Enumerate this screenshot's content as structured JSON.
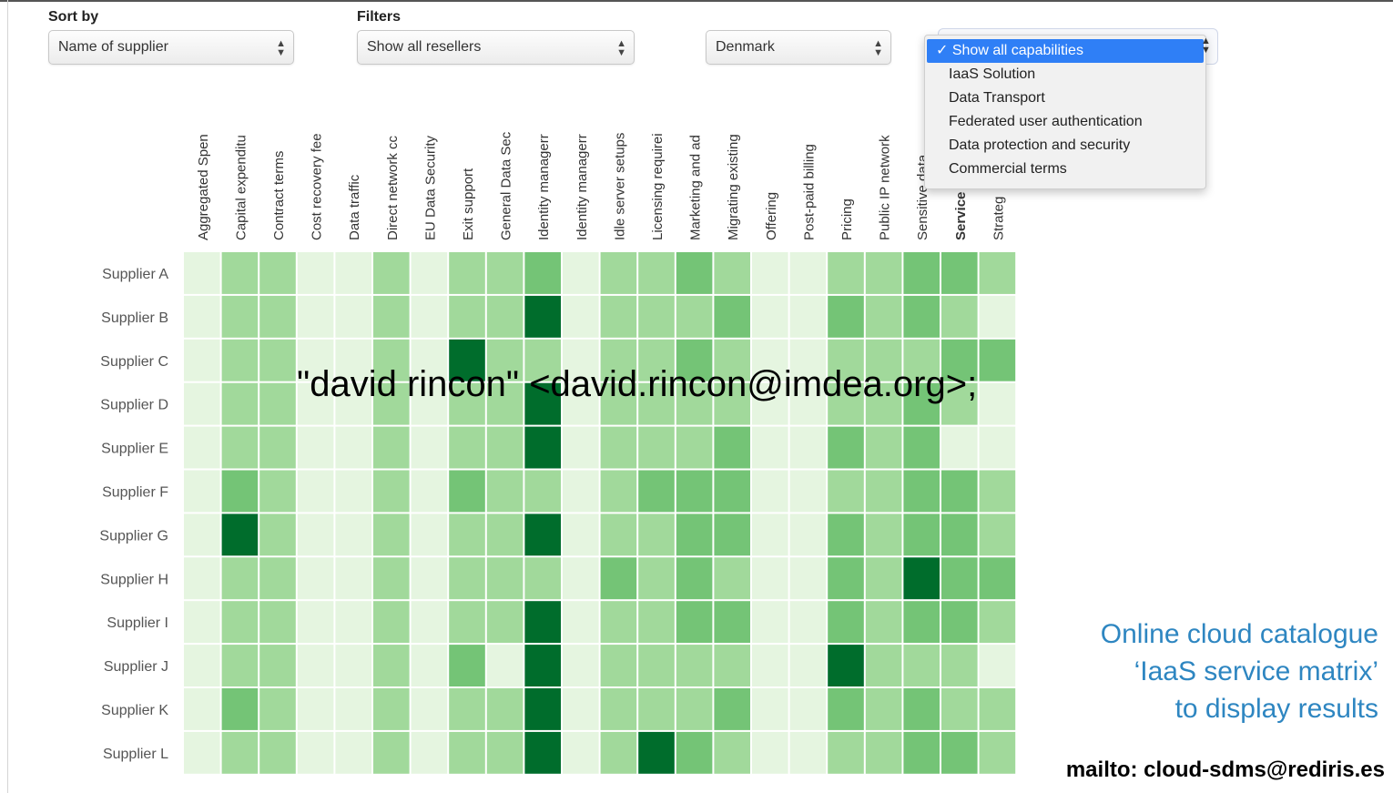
{
  "controls": {
    "sort_label": "Sort by",
    "filters_label": "Filters",
    "sort_value": "Name of supplier",
    "reseller_value": "Show all resellers",
    "country_value": "Denmark"
  },
  "capability_menu": {
    "selected": "Show all capabilities",
    "options": [
      "IaaS Solution",
      "Data Transport",
      "Federated user authentication",
      "Data protection and security",
      "Commercial terms"
    ]
  },
  "chart_data": {
    "type": "heatmap",
    "value_scale": "0 = lightest green, 4 = darkest green",
    "columns": [
      "Aggregated Spen",
      "Capital expenditu",
      "Contract terms",
      "Cost recovery fee",
      "Data traffic",
      "Direct network cc",
      "EU Data Security",
      "Exit support",
      "General Data Sec",
      "Identity managerr",
      "Identity managerr",
      "Idle server setups",
      "Licensing requirei",
      "Marketing and ad",
      "Migrating existing",
      "Offering",
      "Post-paid billing",
      "Pricing",
      "Public IP network",
      "Sensitive data",
      "Service",
      "Strateg"
    ],
    "bold_column": "Service",
    "rows": [
      "Supplier A",
      "Supplier B",
      "Supplier C",
      "Supplier D",
      "Supplier E",
      "Supplier F",
      "Supplier G",
      "Supplier H",
      "Supplier I",
      "Supplier J",
      "Supplier K",
      "Supplier L"
    ],
    "values": [
      [
        0,
        1,
        1,
        0,
        0,
        1,
        0,
        1,
        1,
        2,
        0,
        1,
        1,
        2,
        1,
        0,
        0,
        1,
        1,
        2,
        2,
        1
      ],
      [
        0,
        1,
        1,
        0,
        0,
        1,
        0,
        1,
        1,
        4,
        0,
        1,
        1,
        1,
        2,
        0,
        0,
        2,
        1,
        2,
        1,
        0
      ],
      [
        0,
        1,
        1,
        0,
        0,
        1,
        0,
        4,
        1,
        1,
        0,
        1,
        1,
        2,
        1,
        0,
        0,
        1,
        1,
        1,
        2,
        2
      ],
      [
        0,
        1,
        1,
        0,
        0,
        1,
        0,
        1,
        1,
        4,
        0,
        1,
        1,
        1,
        1,
        0,
        0,
        1,
        1,
        2,
        1,
        0
      ],
      [
        0,
        1,
        1,
        0,
        0,
        1,
        0,
        1,
        1,
        4,
        0,
        1,
        1,
        1,
        2,
        0,
        0,
        2,
        1,
        2,
        0,
        0
      ],
      [
        0,
        2,
        1,
        0,
        0,
        1,
        0,
        2,
        1,
        1,
        0,
        1,
        2,
        2,
        2,
        0,
        0,
        1,
        1,
        2,
        2,
        1
      ],
      [
        0,
        4,
        1,
        0,
        0,
        1,
        0,
        1,
        1,
        4,
        0,
        1,
        1,
        2,
        2,
        0,
        0,
        2,
        1,
        2,
        2,
        1
      ],
      [
        0,
        1,
        1,
        0,
        0,
        1,
        0,
        1,
        1,
        1,
        0,
        2,
        1,
        2,
        1,
        0,
        0,
        2,
        1,
        4,
        2,
        2
      ],
      [
        0,
        1,
        1,
        0,
        0,
        1,
        0,
        1,
        1,
        4,
        0,
        1,
        1,
        2,
        2,
        0,
        0,
        2,
        1,
        2,
        2,
        1
      ],
      [
        0,
        1,
        1,
        0,
        0,
        1,
        0,
        2,
        0,
        4,
        0,
        1,
        1,
        1,
        1,
        0,
        0,
        4,
        1,
        1,
        1,
        0
      ],
      [
        0,
        2,
        1,
        0,
        0,
        1,
        0,
        1,
        1,
        4,
        0,
        1,
        1,
        1,
        2,
        0,
        0,
        2,
        1,
        2,
        1,
        1
      ],
      [
        0,
        1,
        1,
        0,
        0,
        1,
        0,
        1,
        1,
        4,
        0,
        1,
        4,
        2,
        1,
        0,
        0,
        1,
        1,
        2,
        2,
        1
      ]
    ],
    "colors": [
      "#e5f5e0",
      "#a1d99b",
      "#74c476",
      "#41ab5d",
      "#006d2c"
    ]
  },
  "overlay_text": "\"david rincon\" <david.rincon@imdea.org>;",
  "caption_lines": [
    "Online cloud catalogue",
    "‘IaaS service matrix’",
    "to display results"
  ],
  "mailto": "mailto: cloud-sdms@rediris.es"
}
